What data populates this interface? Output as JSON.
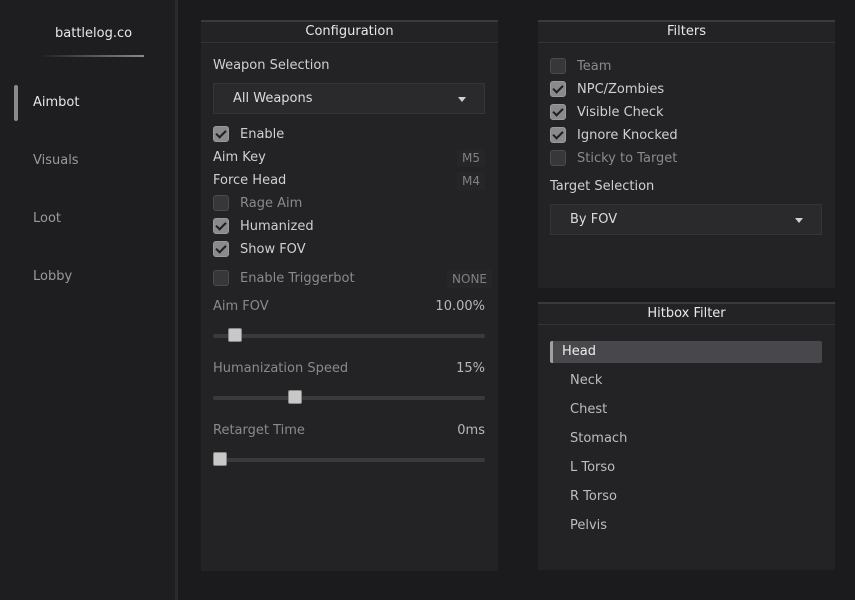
{
  "brand": "battlelog.co",
  "nav": [
    {
      "label": "Aimbot",
      "active": true
    },
    {
      "label": "Visuals",
      "active": false
    },
    {
      "label": "Loot",
      "active": false
    },
    {
      "label": "Lobby",
      "active": false
    }
  ],
  "configuration": {
    "title": "Configuration",
    "weapon_selection_label": "Weapon Selection",
    "weapon_selection_value": "All Weapons",
    "enable": {
      "label": "Enable",
      "checked": true
    },
    "aim_key": {
      "label": "Aim Key",
      "value": "M5"
    },
    "force_head": {
      "label": "Force Head",
      "value": "M4"
    },
    "rage_aim": {
      "label": "Rage Aim",
      "checked": false
    },
    "humanized": {
      "label": "Humanized",
      "checked": true
    },
    "show_fov": {
      "label": "Show FOV",
      "checked": true
    },
    "triggerbot": {
      "label": "Enable Triggerbot",
      "checked": false,
      "key": "NONE"
    },
    "aim_fov": {
      "label": "Aim FOV",
      "value_text": "10.00%",
      "fraction": 0.06
    },
    "humanization_speed": {
      "label": "Humanization Speed",
      "value_text": "15%",
      "fraction": 0.29
    },
    "retarget_time": {
      "label": "Retarget Time",
      "value_text": "0ms",
      "fraction": 0.0
    }
  },
  "filters": {
    "title": "Filters",
    "items": [
      {
        "label": "Team",
        "checked": false
      },
      {
        "label": "NPC/Zombies",
        "checked": true
      },
      {
        "label": "Visible Check",
        "checked": true
      },
      {
        "label": "Ignore Knocked",
        "checked": true
      },
      {
        "label": "Sticky to Target",
        "checked": false
      }
    ],
    "target_selection_label": "Target Selection",
    "target_selection_value": "By FOV"
  },
  "hitbox": {
    "title": "Hitbox Filter",
    "items": [
      "Head",
      "Neck",
      "Chest",
      "Stomach",
      "L Torso",
      "R Torso",
      "Pelvis"
    ],
    "selected": "Head"
  }
}
